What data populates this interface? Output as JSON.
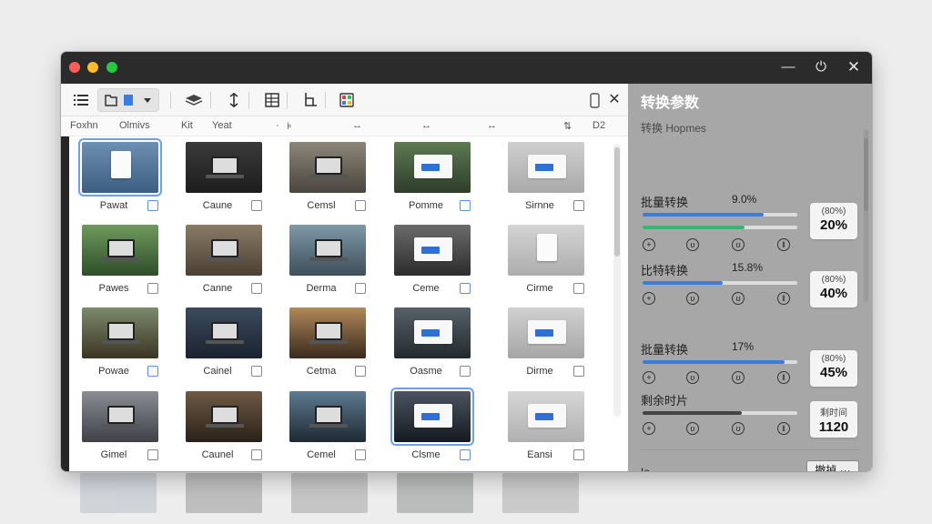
{
  "titlebar": {
    "controls": {
      "minimize": "—",
      "maximize": "⏻",
      "close": "✕"
    }
  },
  "toolbar": {
    "icons": [
      "list-icon",
      "folder-icon",
      "file-icon",
      "dropdown-icon",
      "stack-icon",
      "align-icon",
      "table-icon",
      "crop-icon",
      "palette-icon",
      "phone-icon",
      "close-icon"
    ],
    "close_label": "✕"
  },
  "column_headers": [
    "Foxhn",
    "Olmivs",
    "Kit",
    "Yeat",
    "·",
    "⊧",
    "↔",
    "↔",
    "↔",
    "⇅",
    "D2"
  ],
  "grid": {
    "rows": [
      [
        {
          "label": "Pawat",
          "cb": "blue",
          "selected": true
        },
        {
          "label": "Caune",
          "cb": "gray"
        },
        {
          "label": "Cemsl",
          "cb": "gray"
        },
        {
          "label": "Pomme",
          "cb": "blue"
        },
        {
          "label": "Sirnne",
          "cb": "gray"
        }
      ],
      [
        {
          "label": "Pawes",
          "cb": "gray"
        },
        {
          "label": "Canne",
          "cb": "gray"
        },
        {
          "label": "Derma",
          "cb": "gray"
        },
        {
          "label": "Ceme",
          "cb": "blue"
        },
        {
          "label": "Cirme",
          "cb": "gray"
        }
      ],
      [
        {
          "label": "Powae",
          "cb": "blue"
        },
        {
          "label": "Cainel",
          "cb": "gray"
        },
        {
          "label": "Cetma",
          "cb": "gray"
        },
        {
          "label": "Oasme",
          "cb": "gray"
        },
        {
          "label": "Dirme",
          "cb": "gray"
        }
      ],
      [
        {
          "label": "Gimel",
          "cb": "gray"
        },
        {
          "label": "Caunel",
          "cb": "gray"
        },
        {
          "label": "Cemel",
          "cb": "gray"
        },
        {
          "label": "Clsme",
          "cb": "blue",
          "selected": true
        },
        {
          "label": "Eansi",
          "cb": "gray"
        }
      ]
    ]
  },
  "side_panel": {
    "title": "转换参数",
    "subtitle": "转换 Hopmes",
    "items": [
      {
        "name": "批量转换",
        "value": "9.0%",
        "box_small": "(80%)",
        "box_large": "20%",
        "progress": 0.78,
        "color": "#3a7de0",
        "second_progress": 0.66,
        "second_color": "#3cb371"
      },
      {
        "name": "比特转换",
        "value": "15.8%",
        "box_small": "(80%)",
        "box_large": "40%",
        "progress": 0.52,
        "color": "#3a7de0"
      },
      {
        "name": "批量转换",
        "value": "17%",
        "box_small": "(80%)",
        "box_large": "45%",
        "progress": 0.92,
        "color": "#3a7de0"
      },
      {
        "name": "剩余时片",
        "value": "",
        "box_small": "剩时间",
        "box_large": "1120",
        "progress": 0.64,
        "color": "#444444"
      }
    ],
    "bottom_label": "Ia",
    "button": "撤掉 ···"
  }
}
